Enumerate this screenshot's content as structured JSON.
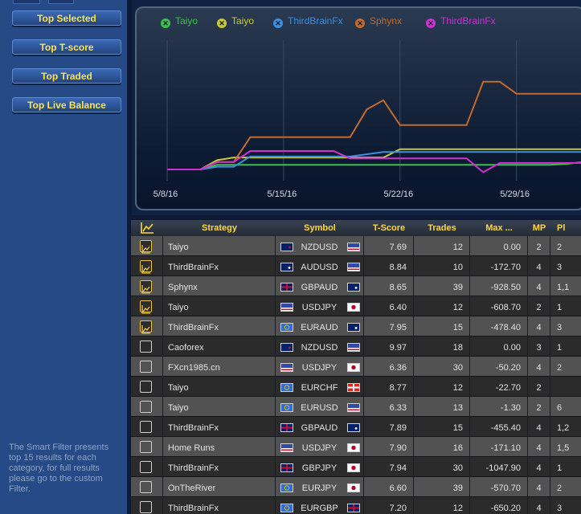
{
  "sidebar": {
    "buttons": [
      {
        "label": "Top Selected",
        "active": true
      },
      {
        "label": "Top T-score",
        "active": false
      },
      {
        "label": "Top Traded",
        "active": false
      },
      {
        "label": "Top Live Balance",
        "active": false
      }
    ],
    "note": "The Smart Filter presents top 15 results for each category, for full results please go to the custom Filter."
  },
  "chart_data": {
    "type": "line",
    "x_tick_labels": [
      "5/8/16",
      "5/15/16",
      "5/22/16",
      "5/29/16"
    ],
    "x_range": [
      "2016-05-08",
      "2016-06-05"
    ],
    "grid": "vertical lines at each date tick",
    "legend_position": "top",
    "series": [
      {
        "name": "Taiyo",
        "color": "#3cc04a",
        "x": [
          "2016-05-08",
          "2016-05-09",
          "2016-05-10",
          "2016-05-11",
          "2016-05-31",
          "2016-06-01",
          "2016-06-02",
          "2016-06-04"
        ],
        "y": [
          0,
          0,
          0,
          5,
          5,
          6,
          8,
          8
        ]
      },
      {
        "name": "Taiyo",
        "color": "#c8c830",
        "x": [
          "2016-05-08",
          "2016-05-09",
          "2016-05-10",
          "2016-05-11",
          "2016-05-12",
          "2016-05-21",
          "2016-05-22",
          "2016-06-02",
          "2016-06-03",
          "2016-06-04"
        ],
        "y": [
          0,
          0,
          0,
          10,
          13,
          13,
          22,
          22,
          29,
          29
        ]
      },
      {
        "name": "ThirdBrainFx",
        "color": "#3a8fe0",
        "x": [
          "2016-05-08",
          "2016-05-09",
          "2016-05-10",
          "2016-05-11",
          "2016-05-12",
          "2016-05-13",
          "2016-05-19",
          "2016-05-21",
          "2016-06-04"
        ],
        "y": [
          0,
          0,
          0,
          3,
          3,
          14,
          14,
          19,
          19
        ]
      },
      {
        "name": "Sphynx",
        "color": "#c26b2c",
        "x": [
          "2016-05-08",
          "2016-05-09",
          "2016-05-10",
          "2016-05-11",
          "2016-05-12",
          "2016-05-13",
          "2016-05-19",
          "2016-05-20",
          "2016-05-21",
          "2016-05-22",
          "2016-05-26",
          "2016-05-27",
          "2016-05-28",
          "2016-05-29",
          "2016-06-03",
          "2016-06-04"
        ],
        "y": [
          0,
          0,
          0,
          8,
          8,
          35,
          35,
          65,
          75,
          48,
          48,
          95,
          95,
          82,
          82,
          48
        ]
      },
      {
        "name": "ThirdBrainFx",
        "color": "#d12fd1",
        "x": [
          "2016-05-08",
          "2016-05-09",
          "2016-05-10",
          "2016-05-11",
          "2016-05-12",
          "2016-05-13",
          "2016-05-18",
          "2016-05-19",
          "2016-05-26",
          "2016-05-27",
          "2016-05-28",
          "2016-06-03",
          "2016-06-04"
        ],
        "y": [
          0,
          0,
          0,
          8,
          8,
          20,
          20,
          12,
          12,
          -3,
          7,
          7,
          35
        ]
      }
    ]
  },
  "table": {
    "headers": {
      "icon": "chart-icon",
      "strategy": "Strategy",
      "symbol": "Symbol",
      "tscore": "T-Score",
      "trades": "Trades",
      "max": "Max ...",
      "mp": "MP",
      "pl": "Pl"
    },
    "rows": [
      {
        "checked": true,
        "strategy": "Taiyo",
        "symbol": "NZDUSD",
        "f1": "NZ",
        "f2": "US",
        "tscore": "7.69",
        "trades": "12",
        "max": "0.00",
        "mp": "2",
        "pl": "2"
      },
      {
        "checked": true,
        "strategy": "ThirdBrainFx",
        "symbol": "AUDUSD",
        "f1": "AU",
        "f2": "US",
        "tscore": "8.84",
        "trades": "10",
        "max": "-172.70",
        "mp": "4",
        "pl": "3"
      },
      {
        "checked": true,
        "strategy": "Sphynx",
        "symbol": "GBPAUD",
        "f1": "GB",
        "f2": "AU",
        "tscore": "8.65",
        "trades": "39",
        "max": "-928.50",
        "mp": "4",
        "pl": "1,1"
      },
      {
        "checked": true,
        "strategy": "Taiyo",
        "symbol": "USDJPY",
        "f1": "US",
        "f2": "JP",
        "tscore": "6.40",
        "trades": "12",
        "max": "-608.70",
        "mp": "2",
        "pl": "1"
      },
      {
        "checked": true,
        "strategy": "ThirdBrainFx",
        "symbol": "EURAUD",
        "f1": "EU",
        "f2": "AU",
        "tscore": "7.95",
        "trades": "15",
        "max": "-478.40",
        "mp": "4",
        "pl": "3"
      },
      {
        "checked": false,
        "strategy": "Caoforex",
        "symbol": "NZDUSD",
        "f1": "NZ",
        "f2": "US",
        "tscore": "9.97",
        "trades": "18",
        "max": "0.00",
        "mp": "3",
        "pl": "1"
      },
      {
        "checked": false,
        "strategy": "FXcn1985.cn",
        "symbol": "USDJPY",
        "f1": "US",
        "f2": "JP",
        "tscore": "6.36",
        "trades": "30",
        "max": "-50.20",
        "mp": "4",
        "pl": "2"
      },
      {
        "checked": false,
        "strategy": "Taiyo",
        "symbol": "EURCHF",
        "f1": "EU",
        "f2": "CH",
        "tscore": "8.77",
        "trades": "12",
        "max": "-22.70",
        "mp": "2",
        "pl": ""
      },
      {
        "checked": false,
        "strategy": "Taiyo",
        "symbol": "EURUSD",
        "f1": "EU",
        "f2": "US",
        "tscore": "6.33",
        "trades": "13",
        "max": "-1.30",
        "mp": "2",
        "pl": "6"
      },
      {
        "checked": false,
        "strategy": "ThirdBrainFx",
        "symbol": "GBPAUD",
        "f1": "GB",
        "f2": "AU",
        "tscore": "7.89",
        "trades": "15",
        "max": "-455.40",
        "mp": "4",
        "pl": "1,2"
      },
      {
        "checked": false,
        "strategy": "Home Runs",
        "symbol": "USDJPY",
        "f1": "US",
        "f2": "JP",
        "tscore": "7.90",
        "trades": "16",
        "max": "-171.10",
        "mp": "4",
        "pl": "1,5"
      },
      {
        "checked": false,
        "strategy": "ThirdBrainFx",
        "symbol": "GBPJPY",
        "f1": "GB",
        "f2": "JP",
        "tscore": "7.94",
        "trades": "30",
        "max": "-1047.90",
        "mp": "4",
        "pl": "1"
      },
      {
        "checked": false,
        "strategy": "OnTheRiver",
        "symbol": "EURJPY",
        "f1": "EU",
        "f2": "JP",
        "tscore": "6.60",
        "trades": "39",
        "max": "-570.70",
        "mp": "4",
        "pl": "2"
      },
      {
        "checked": false,
        "strategy": "ThirdBrainFx",
        "symbol": "EURGBP",
        "f1": "EU",
        "f2": "GB",
        "tscore": "7.20",
        "trades": "12",
        "max": "-650.20",
        "mp": "4",
        "pl": "3"
      }
    ]
  }
}
